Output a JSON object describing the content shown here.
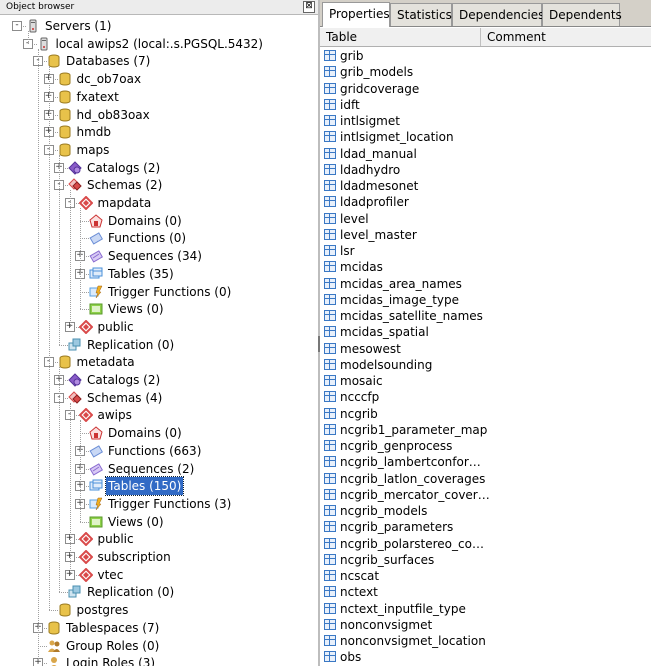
{
  "object_browser": {
    "title": "Object browser",
    "close_glyph": "⊠",
    "tree": [
      {
        "label": "Servers (1)",
        "depth": 0,
        "exp": "-",
        "icon": "servers-icon",
        "color": "#b0b0b0"
      },
      {
        "label": "local awips2 (local:.s.PGSQL.5432)",
        "depth": 1,
        "exp": "-",
        "icon": "server-icon",
        "color": "#a0a0a0"
      },
      {
        "label": "Databases (7)",
        "depth": 2,
        "exp": "-",
        "icon": "databases-icon",
        "color": "#e8c24a"
      },
      {
        "label": "dc_ob7oax",
        "depth": 3,
        "exp": "+",
        "icon": "database-icon",
        "color": "#e8c24a"
      },
      {
        "label": "fxatext",
        "depth": 3,
        "exp": "+",
        "icon": "database-icon",
        "color": "#e8c24a"
      },
      {
        "label": "hd_ob83oax",
        "depth": 3,
        "exp": "+",
        "icon": "database-icon",
        "color": "#e8c24a"
      },
      {
        "label": "hmdb",
        "depth": 3,
        "exp": "+",
        "icon": "database-icon",
        "color": "#e8c24a"
      },
      {
        "label": "maps",
        "depth": 3,
        "exp": "-",
        "icon": "database-icon",
        "color": "#e8c24a"
      },
      {
        "label": "Catalogs (2)",
        "depth": 4,
        "exp": "+",
        "icon": "catalogs-icon",
        "color": "#8a5cc9"
      },
      {
        "label": "Schemas (2)",
        "depth": 4,
        "exp": "-",
        "icon": "schemas-icon",
        "color": "#d94a4a"
      },
      {
        "label": "mapdata",
        "depth": 5,
        "exp": "-",
        "icon": "schema-icon",
        "color": "#d94a4a"
      },
      {
        "label": "Domains (0)",
        "depth": 6,
        "exp": "",
        "icon": "domains-icon",
        "color": "#cc3333"
      },
      {
        "label": "Functions (0)",
        "depth": 6,
        "exp": "",
        "icon": "functions-icon",
        "color": "#6b8ed6"
      },
      {
        "label": "Sequences (34)",
        "depth": 6,
        "exp": "+",
        "icon": "sequences-icon",
        "color": "#8a6cd0"
      },
      {
        "label": "Tables (35)",
        "depth": 6,
        "exp": "+",
        "icon": "tables-icon",
        "color": "#4a90d9"
      },
      {
        "label": "Trigger Functions (0)",
        "depth": 6,
        "exp": "",
        "icon": "trigger-functions-icon",
        "color": "#5aa0e0"
      },
      {
        "label": "Views (0)",
        "depth": 6,
        "exp": "",
        "icon": "views-icon",
        "color": "#8fd14a"
      },
      {
        "label": "public",
        "depth": 5,
        "exp": "+",
        "icon": "schema-icon",
        "color": "#d94a4a"
      },
      {
        "label": "Replication (0)",
        "depth": 4,
        "exp": "",
        "icon": "replication-icon",
        "color": "#4a8fb0"
      },
      {
        "label": "metadata",
        "depth": 3,
        "exp": "-",
        "icon": "database-icon",
        "color": "#e8c24a"
      },
      {
        "label": "Catalogs (2)",
        "depth": 4,
        "exp": "+",
        "icon": "catalogs-icon",
        "color": "#8a5cc9"
      },
      {
        "label": "Schemas (4)",
        "depth": 4,
        "exp": "-",
        "icon": "schemas-icon",
        "color": "#d94a4a"
      },
      {
        "label": "awips",
        "depth": 5,
        "exp": "-",
        "icon": "schema-icon",
        "color": "#d94a4a"
      },
      {
        "label": "Domains (0)",
        "depth": 6,
        "exp": "",
        "icon": "domains-icon",
        "color": "#cc3333"
      },
      {
        "label": "Functions (663)",
        "depth": 6,
        "exp": "+",
        "icon": "functions-icon",
        "color": "#6b8ed6"
      },
      {
        "label": "Sequences (2)",
        "depth": 6,
        "exp": "+",
        "icon": "sequences-icon",
        "color": "#8a6cd0"
      },
      {
        "label": "Tables (150)",
        "depth": 6,
        "exp": "+",
        "icon": "tables-icon",
        "color": "#4a90d9",
        "selected": true
      },
      {
        "label": "Trigger Functions (3)",
        "depth": 6,
        "exp": "+",
        "icon": "trigger-functions-icon",
        "color": "#5aa0e0"
      },
      {
        "label": "Views (0)",
        "depth": 6,
        "exp": "",
        "icon": "views-icon",
        "color": "#8fd14a"
      },
      {
        "label": "public",
        "depth": 5,
        "exp": "+",
        "icon": "schema-icon",
        "color": "#d94a4a"
      },
      {
        "label": "subscription",
        "depth": 5,
        "exp": "+",
        "icon": "schema-icon",
        "color": "#d94a4a"
      },
      {
        "label": "vtec",
        "depth": 5,
        "exp": "+",
        "icon": "schema-icon",
        "color": "#d94a4a"
      },
      {
        "label": "Replication (0)",
        "depth": 4,
        "exp": "",
        "icon": "replication-icon",
        "color": "#4a8fb0"
      },
      {
        "label": "postgres",
        "depth": 3,
        "exp": "",
        "icon": "database-icon",
        "color": "#e8c24a"
      },
      {
        "label": "Tablespaces (7)",
        "depth": 2,
        "exp": "+",
        "icon": "tablespaces-icon",
        "color": "#e8c24a"
      },
      {
        "label": "Group Roles (0)",
        "depth": 2,
        "exp": "",
        "icon": "group-roles-icon",
        "color": "#d9a64a"
      },
      {
        "label": "Login Roles (3)",
        "depth": 2,
        "exp": "+",
        "icon": "login-roles-icon",
        "color": "#d9a64a"
      }
    ]
  },
  "tabs": [
    {
      "label": "Properties",
      "active": true
    },
    {
      "label": "Statistics",
      "active": false
    },
    {
      "label": "Dependencies",
      "active": false
    },
    {
      "label": "Dependents",
      "active": false
    }
  ],
  "columns": [
    "Table",
    "Comment"
  ],
  "tables": [
    "grib",
    "grib_models",
    "gridcoverage",
    "idft",
    "intlsigmet",
    "intlsigmet_location",
    "ldad_manual",
    "ldadhydro",
    "ldadmesonet",
    "ldadprofiler",
    "level",
    "level_master",
    "lsr",
    "mcidas",
    "mcidas_area_names",
    "mcidas_image_type",
    "mcidas_satellite_names",
    "mcidas_spatial",
    "mesowest",
    "modelsounding",
    "mosaic",
    "ncccfp",
    "ncgrib",
    "ncgrib1_parameter_map",
    "ncgrib_genprocess",
    "ncgrib_lambertconfor…",
    "ncgrib_latlon_coverages",
    "ncgrib_mercator_cover…",
    "ncgrib_models",
    "ncgrib_parameters",
    "ncgrib_polarstereo_co…",
    "ncgrib_surfaces",
    "ncscat",
    "nctext",
    "nctext_inputfile_type",
    "nonconvsigmet",
    "nonconvsigmet_location",
    "obs"
  ]
}
